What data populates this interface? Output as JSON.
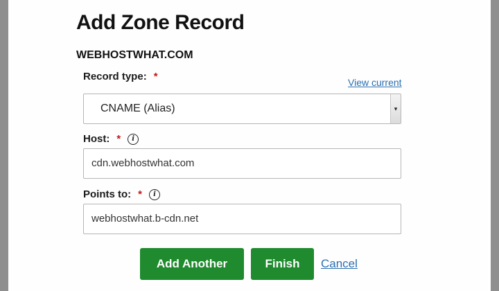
{
  "dialog": {
    "title": "Add Zone Record",
    "domain": "WEBHOSTWHAT.COM"
  },
  "record_type": {
    "label": "Record type:",
    "required_marker": "*",
    "view_current_link": "View current",
    "selected_value": "CNAME (Alias)",
    "arrow_glyph": "▾"
  },
  "host": {
    "label": "Host:",
    "required_marker": "*",
    "info_glyph": "i",
    "value": "cdn.webhostwhat.com"
  },
  "points_to": {
    "label": "Points to:",
    "required_marker": "*",
    "info_glyph": "i",
    "value": "webhostwhat.b-cdn.net"
  },
  "actions": {
    "add_another": "Add Another",
    "finish": "Finish",
    "cancel": "Cancel"
  },
  "colors": {
    "primary_button": "#1f8a2e",
    "link": "#2a6fb0",
    "required": "#c0171b"
  }
}
